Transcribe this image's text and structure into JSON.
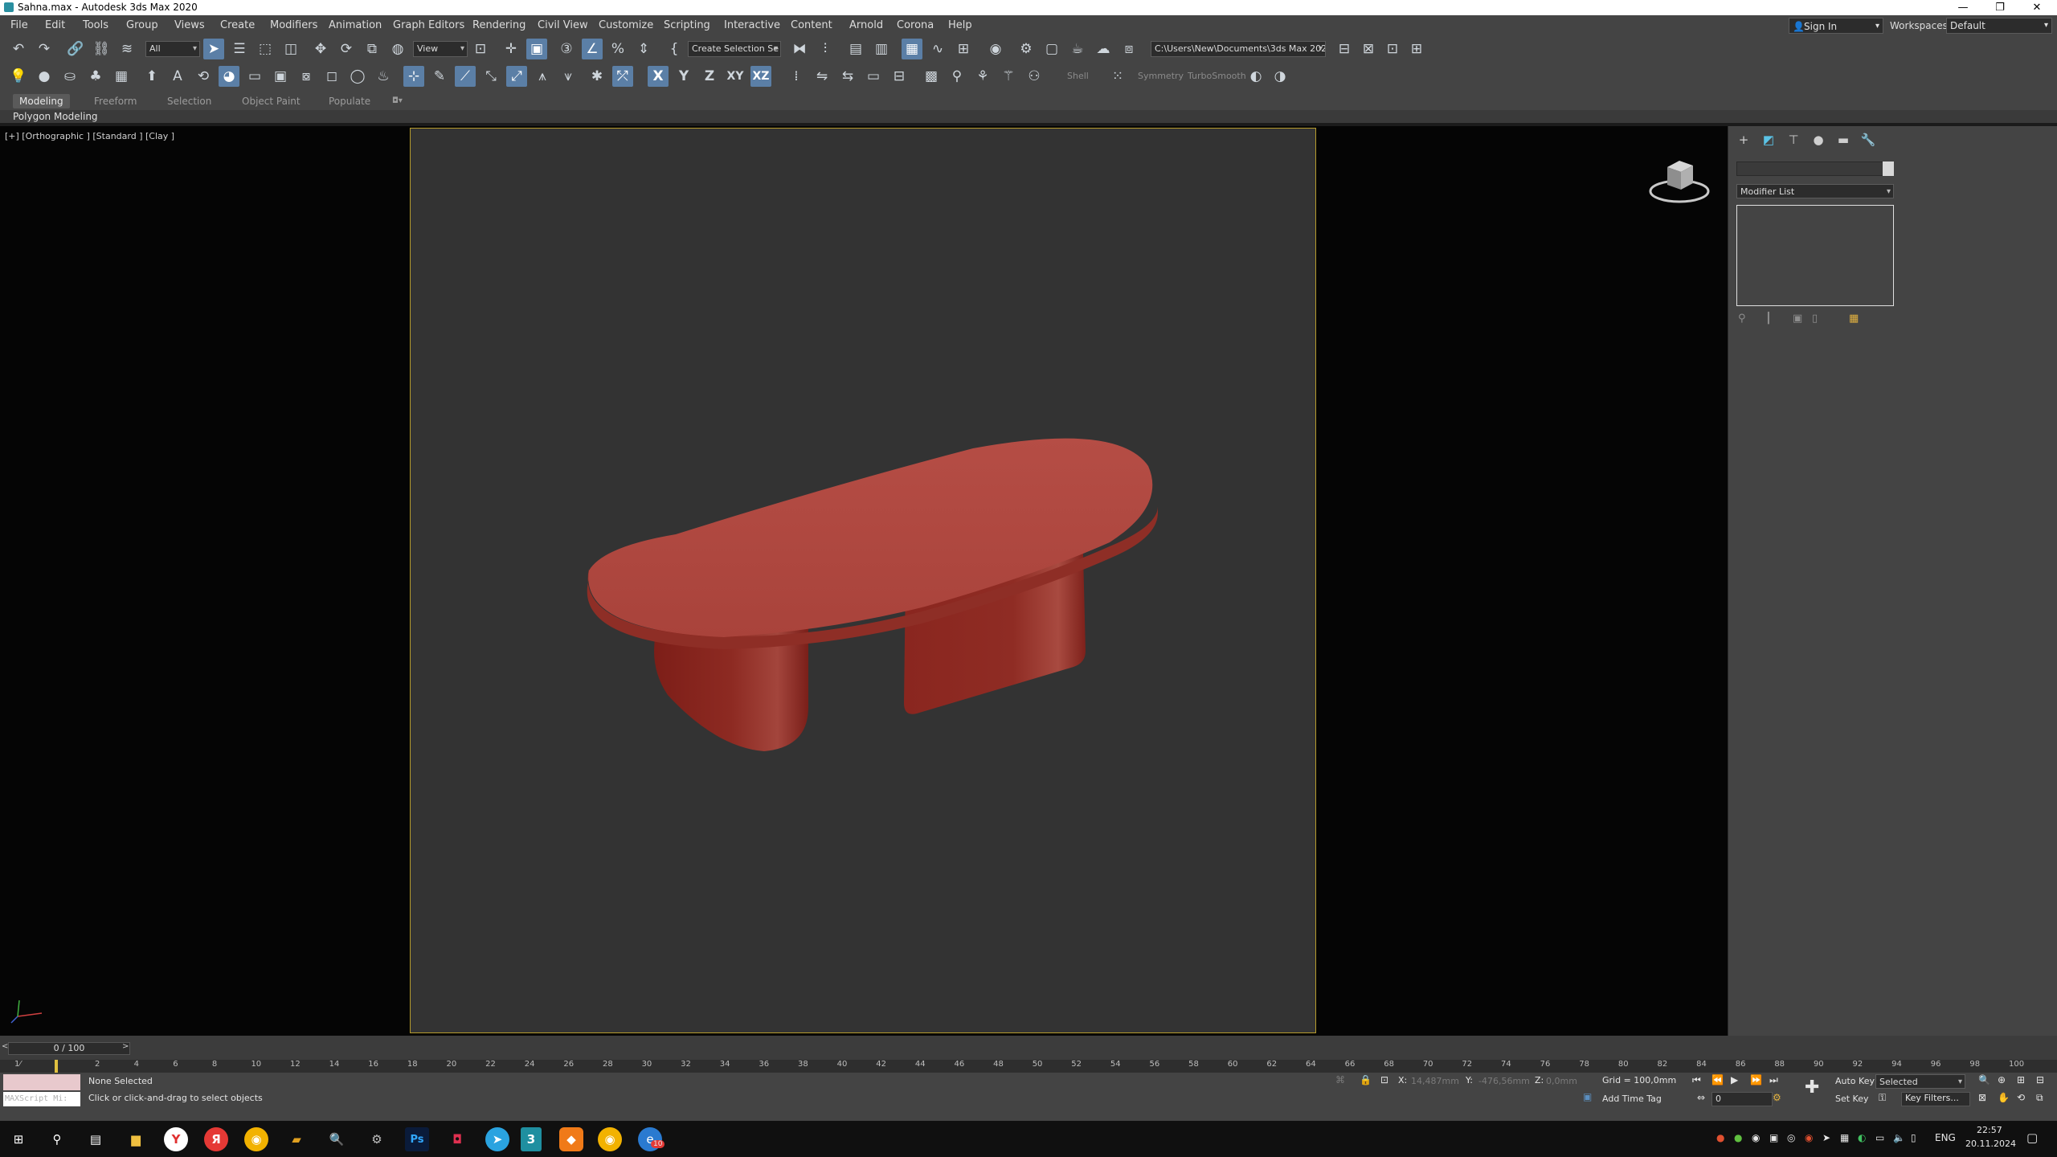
{
  "window": {
    "title": "Sahna.max - Autodesk 3ds Max 2020"
  },
  "menu": [
    "File",
    "Edit",
    "Tools",
    "Group",
    "Views",
    "Create",
    "Modifiers",
    "Animation",
    "Graph Editors",
    "Rendering",
    "Civil View",
    "Customize",
    "Scripting",
    "Interactive",
    "Content",
    "Arnold",
    "Corona",
    "Help"
  ],
  "account": {
    "signin": "Sign In",
    "workspaces_label": "Workspaces:",
    "workspace": "Default"
  },
  "toolbar": {
    "filter": "All",
    "ref_coord": "View",
    "selection_set": "Create Selection Se",
    "project_path": "C:\\Users\\New\\Documents\\3ds Max 2020",
    "axis_x": "X",
    "axis_y": "Y",
    "axis_z": "Z",
    "axis_xy": "XY",
    "axis_xz": "XZ",
    "shell": "Shell",
    "symmetry": "Symmetry",
    "turbosmooth": "TurboSmooth"
  },
  "ribbon": {
    "tabs": [
      "Modeling",
      "Freeform",
      "Selection",
      "Object Paint",
      "Populate"
    ],
    "panel": "Polygon Modeling"
  },
  "viewport": {
    "label": "[+] [Orthographic ] [Standard ] [Clay ]",
    "object_color": "#b54a42",
    "frame_color": "#b69b2b"
  },
  "command_panel": {
    "modifier_list": "Modifier List"
  },
  "timeline": {
    "slider": "0 / 100",
    "ticks": [
      "2",
      "4",
      "6",
      "8",
      "10",
      "12",
      "14",
      "16",
      "18",
      "20",
      "22",
      "24",
      "26",
      "28",
      "30",
      "32",
      "34",
      "36",
      "38",
      "40",
      "42",
      "44",
      "46",
      "48",
      "50",
      "52",
      "54",
      "56",
      "58",
      "60",
      "62",
      "64",
      "66",
      "68",
      "70",
      "72",
      "74",
      "76",
      "78",
      "80",
      "82",
      "84",
      "86",
      "88",
      "90",
      "92",
      "94",
      "96",
      "98",
      "100"
    ]
  },
  "status": {
    "maxscript": "MAXScript Mi:",
    "selection": "None Selected",
    "prompt": "Click or click-and-drag to select objects",
    "x_label": "X:",
    "x_val": "14,487mm",
    "y_label": "Y:",
    "y_val": "-476,56mm",
    "z_label": "Z:",
    "z_val": "0,0mm",
    "grid": "Grid = 100,0mm",
    "add_time_tag": "Add Time Tag",
    "auto_key": "Auto Key",
    "selected": "Selected",
    "set_key": "Set Key",
    "key_filters": "Key Filters...",
    "frame": "0"
  },
  "taskbar": {
    "lang": "ENG",
    "time": "22:57",
    "date": "20.11.2024",
    "badge": "10"
  }
}
